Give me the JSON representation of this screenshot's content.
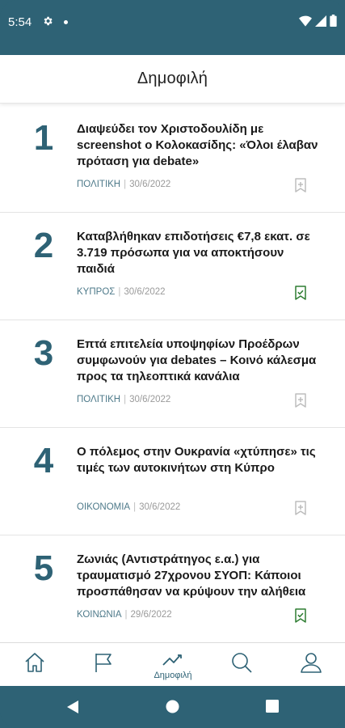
{
  "status_bar": {
    "time": "5:54"
  },
  "header": {
    "title": "Δημοφιλή"
  },
  "articles": [
    {
      "rank": "1",
      "title": "Διαψεύδει τον Χριστοδουλίδη με screenshot ο Κολοκασίδης: «Όλοι έλαβαν πρόταση για debate»",
      "category": "ΠΟΛΙΤΙΚΗ",
      "separator": "|",
      "date": "30/6/2022",
      "bookmarked": false
    },
    {
      "rank": "2",
      "title": "Καταβλήθηκαν επιδοτήσεις €7,8 εκατ. σε 3.719 πρόσωπα για να αποκτήσουν παιδιά",
      "category": "ΚΥΠΡΟΣ",
      "separator": "|",
      "date": "30/6/2022",
      "bookmarked": true
    },
    {
      "rank": "3",
      "title": "Επτά επιτελεία υποψηφίων Προέδρων συμφωνούν για debates – Κοινό κάλεσμα προς τα τηλεοπτικά κανάλια",
      "category": "ΠΟΛΙΤΙΚΗ",
      "separator": "|",
      "date": "30/6/2022",
      "bookmarked": false
    },
    {
      "rank": "4",
      "title": "Ο πόλεμος στην Ουκρανία «χτύπησε» τις τιμές των αυτοκινήτων στη Κύπρο",
      "category": "ΟΙΚΟΝΟΜΙΑ",
      "separator": "|",
      "date": "30/6/2022",
      "bookmarked": false
    },
    {
      "rank": "5",
      "title": "Ζωνιάς (Αντιστράτηγος ε.α.) για τραυματισμό 27χρονου ΣΥΟΠ: Κάποιοι προσπάθησαν να κρύψουν την αλήθεια",
      "category": "ΚΟΙΝΩΝΙΑ",
      "separator": "|",
      "date": "29/6/2022",
      "bookmarked": true
    }
  ],
  "bottom_nav": {
    "items": [
      {
        "icon": "home-icon",
        "label": ""
      },
      {
        "icon": "flag-icon",
        "label": ""
      },
      {
        "icon": "trending-icon",
        "label": "Δημοφιλή",
        "active": true
      },
      {
        "icon": "search-icon",
        "label": ""
      },
      {
        "icon": "user-icon",
        "label": ""
      }
    ]
  },
  "colors": {
    "primary": "#2e6275",
    "bookmark_active": "#2e7d32",
    "bookmark_inactive": "#bdbdbd"
  }
}
